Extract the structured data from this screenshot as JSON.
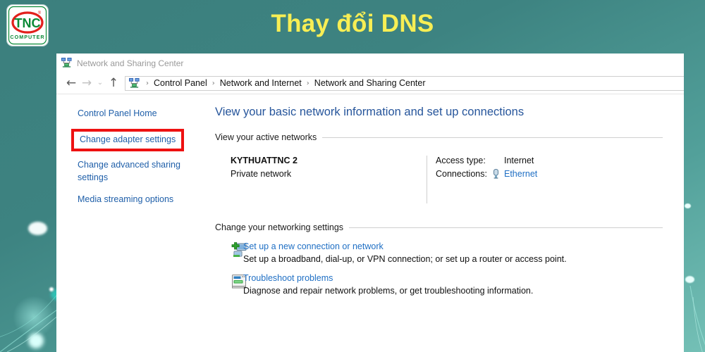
{
  "banner": {
    "title": "Thay đổi DNS",
    "title_color": "#f7ee54",
    "background_color": "#3d8381",
    "logo": {
      "name": "tnc-computer-logo",
      "primary_text": "TNC",
      "secondary_text": "COMPUTER",
      "registered_mark": "®",
      "green": "#0a8a36",
      "red": "#e2201c"
    }
  },
  "window": {
    "titlebar": {
      "icon": "network-sharing-center-icon",
      "title": "Network and Sharing Center"
    },
    "addressbar": {
      "back_icon": "back-arrow-icon",
      "forward_icon": "forward-arrow-icon",
      "history_icon": "chevron-down-icon",
      "up_icon": "up-arrow-icon",
      "path_icon": "network-icon",
      "separator": "›",
      "breadcrumbs": [
        "Control Panel",
        "Network and Internet",
        "Network and Sharing Center"
      ]
    },
    "sidebar": {
      "items": [
        {
          "label": "Control Panel Home",
          "highlighted": false
        },
        {
          "label": "Change adapter settings",
          "highlighted": true
        },
        {
          "label": "Change advanced sharing settings",
          "highlighted": false
        },
        {
          "label": "Media streaming options",
          "highlighted": false
        }
      ],
      "highlight_color": "#ee1111"
    },
    "content": {
      "heading": "View your basic network information and set up connections",
      "active_networks": {
        "section_title": "View your active networks",
        "network_name": "KYTHUATTNC 2",
        "network_type": "Private network",
        "access_type_label": "Access type:",
        "access_type_value": "Internet",
        "connections_label": "Connections:",
        "connections_icon": "ethernet-icon",
        "connections_value": "Ethernet"
      },
      "networking_settings": {
        "section_title": "Change your networking settings",
        "items": [
          {
            "icon": "new-connection-icon",
            "link": "Set up a new connection or network",
            "description": "Set up a broadband, dial-up, or VPN connection; or set up a router or access point."
          },
          {
            "icon": "troubleshoot-icon",
            "link": "Troubleshoot problems",
            "description": "Diagnose and repair network problems, or get troubleshooting information."
          }
        ]
      }
    }
  }
}
